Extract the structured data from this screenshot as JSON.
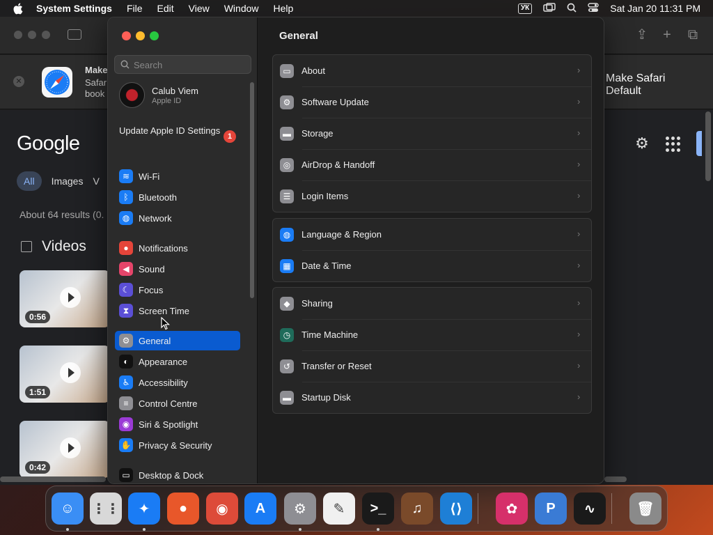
{
  "menubar": {
    "app_name": "System Settings",
    "menus": [
      "File",
      "Edit",
      "View",
      "Window",
      "Help"
    ],
    "keyboard_layout": "УК",
    "datetime": "Sat Jan 20  11:31 PM"
  },
  "safari": {
    "banner": {
      "line1": "Make",
      "line2": "Safar",
      "line3": "book",
      "default_button": "Make Safari Default"
    },
    "google_logo": "Google",
    "search_tabs": [
      "All",
      "Images",
      "V"
    ],
    "result_count": "About 64 results (0.",
    "videos_title": "Videos",
    "videos": [
      {
        "duration": "0:56"
      },
      {
        "duration": "1:51"
      },
      {
        "duration": "0:42"
      }
    ]
  },
  "settings": {
    "search_placeholder": "Search",
    "profile": {
      "name": "Calub Viem",
      "subtitle": "Apple ID"
    },
    "update": {
      "label": "Update Apple ID Settings",
      "badge": "1"
    },
    "sidebar": [
      {
        "label": "Wi-Fi",
        "icon": "wifi-icon",
        "color": "#1a7cf5",
        "glyph": "≋"
      },
      {
        "label": "Bluetooth",
        "icon": "bluetooth-icon",
        "color": "#1a7cf5",
        "glyph": "ᛒ"
      },
      {
        "label": "Network",
        "icon": "globe-icon",
        "color": "#1a7cf5",
        "glyph": "◍"
      },
      {
        "label": "Notifications",
        "icon": "bell-icon",
        "color": "#e5453a",
        "glyph": "●"
      },
      {
        "label": "Sound",
        "icon": "speaker-icon",
        "color": "#e5456a",
        "glyph": "◀"
      },
      {
        "label": "Focus",
        "icon": "moon-icon",
        "color": "#5b4fd6",
        "glyph": "☾"
      },
      {
        "label": "Screen Time",
        "icon": "hourglass-icon",
        "color": "#5b4fd6",
        "glyph": "⧗"
      },
      {
        "label": "General",
        "icon": "gear-icon",
        "color": "#8e8e93",
        "glyph": "⚙",
        "selected": true
      },
      {
        "label": "Appearance",
        "icon": "appearance-icon",
        "color": "#111111",
        "glyph": "◐"
      },
      {
        "label": "Accessibility",
        "icon": "accessibility-icon",
        "color": "#1a7cf5",
        "glyph": "♿"
      },
      {
        "label": "Control Centre",
        "icon": "toggles-icon",
        "color": "#8e8e93",
        "glyph": "≡"
      },
      {
        "label": "Siri & Spotlight",
        "icon": "siri-icon",
        "color": "#9b3bd6",
        "glyph": "◉"
      },
      {
        "label": "Privacy & Security",
        "icon": "hand-icon",
        "color": "#1a7cf5",
        "glyph": "✋"
      },
      {
        "label": "Desktop & Dock",
        "icon": "dock-icon",
        "color": "#111111",
        "glyph": "▭"
      }
    ],
    "main": {
      "title": "General",
      "groups": [
        [
          {
            "label": "About",
            "icon": "display-icon",
            "color": "#8e8e93",
            "glyph": "▭"
          },
          {
            "label": "Software Update",
            "icon": "gear-update-icon",
            "color": "#8e8e93",
            "glyph": "⚙"
          },
          {
            "label": "Storage",
            "icon": "drive-icon",
            "color": "#8e8e93",
            "glyph": "▬"
          },
          {
            "label": "AirDrop & Handoff",
            "icon": "airdrop-icon",
            "color": "#8e8e93",
            "glyph": "◎"
          },
          {
            "label": "Login Items",
            "icon": "list-icon",
            "color": "#8e8e93",
            "glyph": "☰"
          }
        ],
        [
          {
            "label": "Language & Region",
            "icon": "globe-icon",
            "color": "#1a7cf5",
            "glyph": "◍"
          },
          {
            "label": "Date & Time",
            "icon": "calendar-icon",
            "color": "#1a7cf5",
            "glyph": "▦"
          }
        ],
        [
          {
            "label": "Sharing",
            "icon": "sharing-icon",
            "color": "#8e8e93",
            "glyph": "◆"
          },
          {
            "label": "Time Machine",
            "icon": "clock-icon",
            "color": "#1f6b5a",
            "glyph": "◷"
          },
          {
            "label": "Transfer or Reset",
            "icon": "reset-icon",
            "color": "#8e8e93",
            "glyph": "↺"
          },
          {
            "label": "Startup Disk",
            "icon": "disk-icon",
            "color": "#8e8e93",
            "glyph": "▬"
          }
        ]
      ]
    }
  },
  "dock": [
    {
      "name": "finder-icon",
      "color": "#3a8ef5",
      "glyph": "☺",
      "running": true
    },
    {
      "name": "launchpad-icon",
      "color": "#d8d8d8",
      "glyph": "⋮⋮",
      "running": false
    },
    {
      "name": "safari-icon",
      "color": "#1a7cf5",
      "glyph": "✦",
      "running": true
    },
    {
      "name": "firefox-icon",
      "color": "#e8572a",
      "glyph": "●",
      "running": false
    },
    {
      "name": "chrome-icon",
      "color": "#dd4b39",
      "glyph": "◉",
      "running": false
    },
    {
      "name": "app-store-icon",
      "color": "#1a7cf5",
      "glyph": "A",
      "running": false
    },
    {
      "name": "system-settings-icon",
      "color": "#8e8e93",
      "glyph": "⚙",
      "running": true
    },
    {
      "name": "textedit-icon",
      "color": "#f0f0f0",
      "glyph": "✎",
      "running": false
    },
    {
      "name": "terminal-icon",
      "color": "#1a1a1a",
      "glyph": ">_",
      "running": true
    },
    {
      "name": "garageband-icon",
      "color": "#7a4a2a",
      "glyph": "♫",
      "running": false
    },
    {
      "name": "vscode-icon",
      "color": "#1e7fd6",
      "glyph": "⟨⟩",
      "running": false
    },
    {
      "name": "flower-app-icon",
      "color": "#d6306a",
      "glyph": "✿",
      "running": false
    },
    {
      "name": "p-app-icon",
      "color": "#3a7bd5",
      "glyph": "P",
      "running": false
    },
    {
      "name": "activity-monitor-icon",
      "color": "#1a1a1a",
      "glyph": "∿",
      "running": false
    },
    {
      "name": "trash-icon",
      "color": "#8a8a8a",
      "glyph": "🗑",
      "running": false
    }
  ]
}
